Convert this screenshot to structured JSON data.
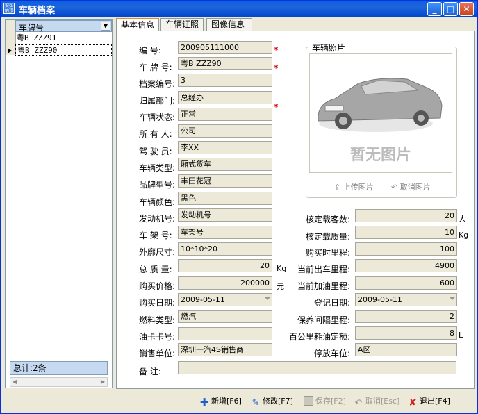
{
  "window": {
    "title": "车辆档案",
    "app_icon_text": "安弘 纳顶"
  },
  "grid": {
    "column_header": "车牌号",
    "rows": [
      "粤B ZZZ91",
      "粤B ZZZ90"
    ],
    "selected_index": 1,
    "total": "总计:2条"
  },
  "tabs": [
    "基本信息",
    "车辆证照",
    "图像信息"
  ],
  "form": {
    "labels": {
      "number": "编    号:",
      "plate": "车 牌 号:",
      "archive_no": "档案编号:",
      "department": "归属部门:",
      "status": "车辆状态:",
      "owner": "所 有 人:",
      "driver": "驾 驶 员:",
      "vehicle_type": "车辆类型:",
      "brand_model": "品牌型号:",
      "color": "车辆颜色:",
      "engine_no": "发动机号:",
      "frame_no": "车 架 号:",
      "dimensions": "外廓尺寸:",
      "total_mass": "总 质 量:",
      "price": "购买价格:",
      "purchase_date": "购买日期:",
      "fuel_type": "燃料类型:",
      "fuel_card": "油卡卡号:",
      "dealer": "销售单位:",
      "remarks": "备    注:",
      "rated_passengers": "核定载客数:",
      "rated_load": "核定载质量:",
      "purchase_mileage": "购买时里程:",
      "current_out_mileage": "当前出车里程:",
      "current_fuel_mileage": "当前加油里程:",
      "register_date": "登记日期:",
      "maintenance_interval": "保养间隔里程:",
      "fuel_per_100km": "百公里耗油定额:",
      "parking": "停放车位:"
    },
    "values": {
      "number": "200905111000",
      "plate": "粤B ZZZ90",
      "archive_no": "3",
      "department": "总经办",
      "status": "正常",
      "owner": "公司",
      "driver": "李XX",
      "vehicle_type": "厢式货车",
      "brand_model": "丰田花冠",
      "color": "黑色",
      "engine_no": "发动机号",
      "frame_no": "车架号",
      "dimensions": "10*10*20",
      "total_mass": "20",
      "price": "200000",
      "purchase_date": "2009-05-11",
      "fuel_type": "燃汽",
      "fuel_card": "",
      "dealer": "深圳一汽4S销售商",
      "remarks": "",
      "rated_passengers": "20",
      "rated_load": "10",
      "purchase_mileage": "100",
      "current_out_mileage": "4900",
      "current_fuel_mileage": "600",
      "register_date": "2009-05-11",
      "maintenance_interval": "2",
      "fuel_per_100km": "8",
      "parking": "A区"
    },
    "units": {
      "total_mass": "Kg",
      "price": "元",
      "rated_passengers": "人",
      "rated_load": "Kg",
      "fuel_per_100km": "L"
    },
    "required_mark": "*"
  },
  "photo": {
    "legend": "车辆照片",
    "placeholder": "暂无图片",
    "upload_label": "上传图片",
    "cancel_label": "取消图片"
  },
  "toolbar": {
    "add": "新增[F6]",
    "edit": "修改[F7]",
    "save": "保存[F2]",
    "cancel": "取消[Esc]",
    "exit": "退出[F4]"
  }
}
